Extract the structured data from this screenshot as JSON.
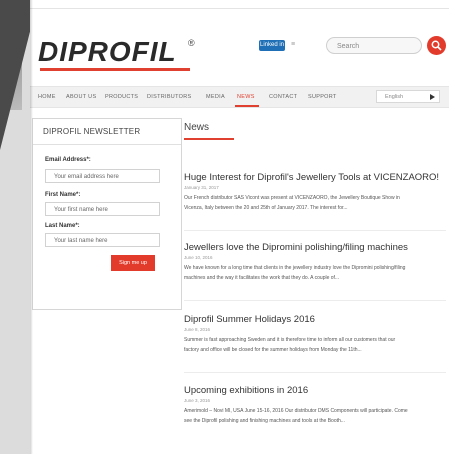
{
  "brand": {
    "name": "DIPROFIL",
    "reg": "®"
  },
  "social": {
    "linkedin_label": "Linked in",
    "follow_icon": "share-icon"
  },
  "search": {
    "placeholder": "Search"
  },
  "nav": {
    "items": [
      "HOME",
      "ABOUT US",
      "PRODUCTS",
      "DISTRIBUTORS",
      "MEDIA",
      "NEWS",
      "CONTACT",
      "SUPPORT"
    ],
    "active": "NEWS",
    "language": "English"
  },
  "newsletter": {
    "title": "DIPROFIL NEWSLETTER",
    "email_label": "Email Address*:",
    "email_placeholder": "Your email address here",
    "first_label": "First Name*:",
    "first_placeholder": "Your first name here",
    "last_label": "Last Name*:",
    "last_placeholder": "Your last name here",
    "button": "Sign me up"
  },
  "main": {
    "title": "News",
    "articles": [
      {
        "title": "Huge Interest for Diprofil's Jewellery Tools at VICENZAORO!",
        "date": "January 31, 2017",
        "lines": [
          "Our French distributor SAS Vicont was present at VICENZAORO, the Jewellery Boutique Show in",
          "Vicenza, Italy between the 20 and 25th of January 2017. The interest for..."
        ]
      },
      {
        "title": "Jewellers love the Dipromini polishing/filing machines",
        "date": "June 10, 2016",
        "lines": [
          "We have known for a long time that clients in the jewellery industry love the Dipromini polishing/filing",
          "machines and the way it facilitates the work that they do. A couple of..."
        ]
      },
      {
        "title": "Diprofil Summer Holidays 2016",
        "date": "June 8, 2016",
        "lines": [
          "Summer is fast approaching Sweden and it is therefore time to inform all our customers that our",
          "factory and office will be closed for the summer holidays from Monday the 11th..."
        ]
      },
      {
        "title": "Upcoming exhibitions in 2016",
        "date": "June 3, 2016",
        "lines": [
          "Amerimold – Novi MI, USA June 15-16, 2016 Our distributor DMS Components will participate. Come",
          "see the Diprofil polishing and finishing machines and tools at the Booth..."
        ]
      }
    ]
  },
  "colors": {
    "accent": "#e04030",
    "linkedin": "#1e6fb5",
    "fold": "#4a4a4a"
  }
}
